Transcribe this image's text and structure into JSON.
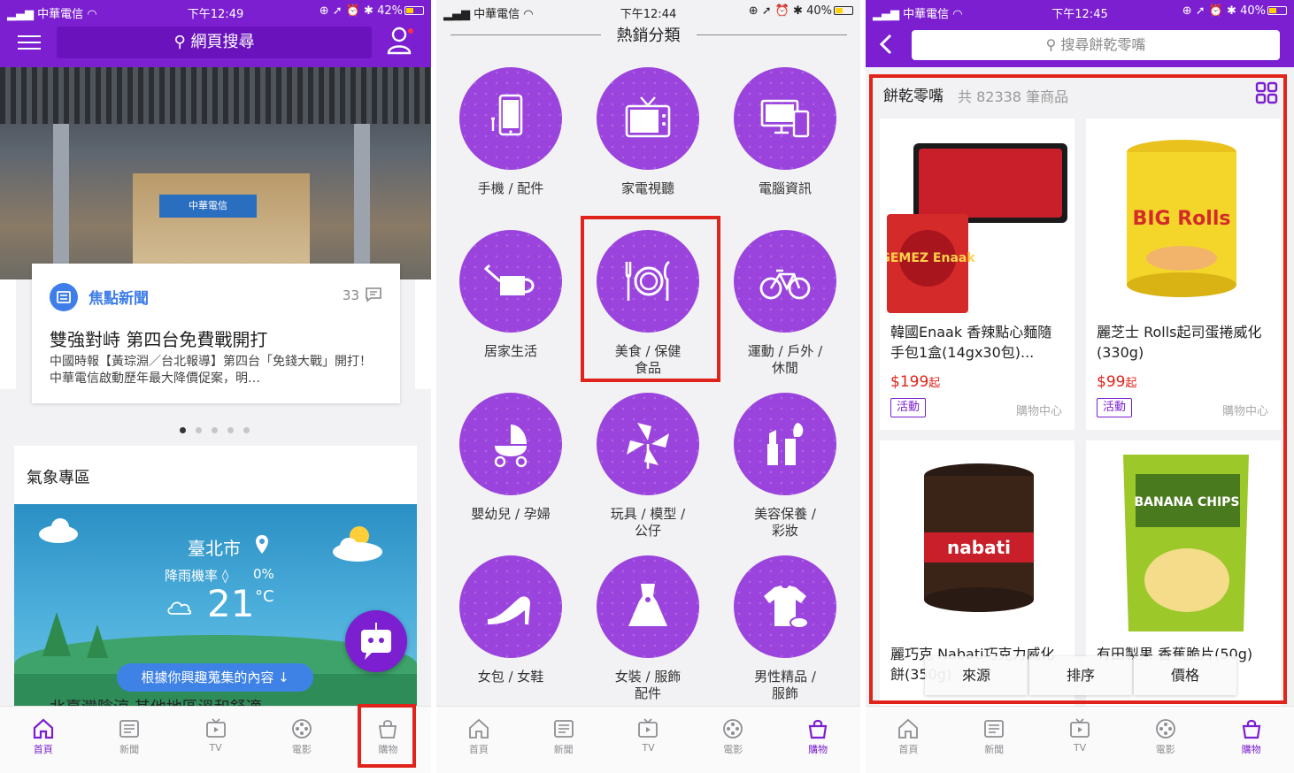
{
  "status": {
    "carrier": "中華電信",
    "panels": [
      {
        "time": "下午12:49",
        "battery": "42%"
      },
      {
        "time": "下午12:44",
        "battery": "40%"
      },
      {
        "time": "下午12:45",
        "battery": "40%"
      }
    ]
  },
  "colors": {
    "brand": "#7b1fd0",
    "highlight": "#e0241b",
    "link": "#3f7ee8",
    "price": "#e0241b"
  },
  "home": {
    "search_label": "網頁搜尋",
    "hero_sign": "中華電信",
    "news": {
      "tag": "焦點新聞",
      "comments": "33",
      "title": "雙強對峙 第四台免費戰開打",
      "desc": "中國時報【黃琮淵／台北報導】第四台「免錢大戰」開打！中華電信啟動歷年最大降價促案，明…"
    },
    "weather": {
      "title": "氣象專區",
      "city": "臺北市",
      "rain_label": "降雨機率",
      "rain_value": "0%",
      "temp": "21",
      "unit": "°C"
    },
    "recommend_label": "根據你興趣蒐集的內容 ↓",
    "clipped_text": "北臺灣陰涼 其他地區溫和舒適"
  },
  "tabs": [
    {
      "label": "首頁",
      "icon": "home-icon"
    },
    {
      "label": "新聞",
      "icon": "news-icon"
    },
    {
      "label": "TV",
      "icon": "tv-icon"
    },
    {
      "label": "電影",
      "icon": "film-icon"
    },
    {
      "label": "購物",
      "icon": "shopping-bag-icon"
    }
  ],
  "categories": {
    "title": "熱銷分類",
    "items": [
      {
        "label": "手機 / 配件",
        "icon": "phone-icon"
      },
      {
        "label": "家電視聽",
        "icon": "tv-icon"
      },
      {
        "label": "電腦資訊",
        "icon": "computer-icon"
      },
      {
        "label": "居家生活",
        "icon": "watering-can-icon"
      },
      {
        "label": "美食 / 保健\n食品",
        "icon": "dining-icon"
      },
      {
        "label": "運動 / 戶外 /\n休閒",
        "icon": "bicycle-icon"
      },
      {
        "label": "嬰幼兒 / 孕婦",
        "icon": "stroller-icon"
      },
      {
        "label": "玩具 / 模型 /\n公仔",
        "icon": "pinwheel-icon"
      },
      {
        "label": "美容保養 /\n彩妝",
        "icon": "cosmetics-icon"
      },
      {
        "label": "女包 / 女鞋",
        "icon": "high-heel-icon"
      },
      {
        "label": "女裝 / 服飾\n配件",
        "icon": "dress-icon"
      },
      {
        "label": "男性精品 /\n服飾",
        "icon": "shirt-icon"
      }
    ]
  },
  "shop": {
    "search_placeholder": "搜尋餅乾零嘴",
    "category_title": "餅乾零嘴",
    "count_text": "共 82338 筆商品",
    "products": [
      {
        "name": "韓國Enaak 香辣點心麵隨手包1盒(14gx30包)...",
        "price": "$199",
        "price_suffix": "起",
        "badge": "活動",
        "shop": "購物中心",
        "img_label": "GEMEZ Enaak"
      },
      {
        "name": "麗芝士 Rolls起司蛋捲威化(330g)",
        "price": "$99",
        "price_suffix": "起",
        "badge": "活動",
        "shop": "購物中心",
        "img_label": "BIG Rolls"
      },
      {
        "name": "麗巧克 Nabati巧克力威化餅(350g)",
        "img_label": "nabati"
      },
      {
        "name": "有田製果 香蕉脆片(50g)",
        "img_label": "BANANA CHIPS"
      }
    ],
    "sort": [
      "來源",
      "排序",
      "價格"
    ]
  }
}
